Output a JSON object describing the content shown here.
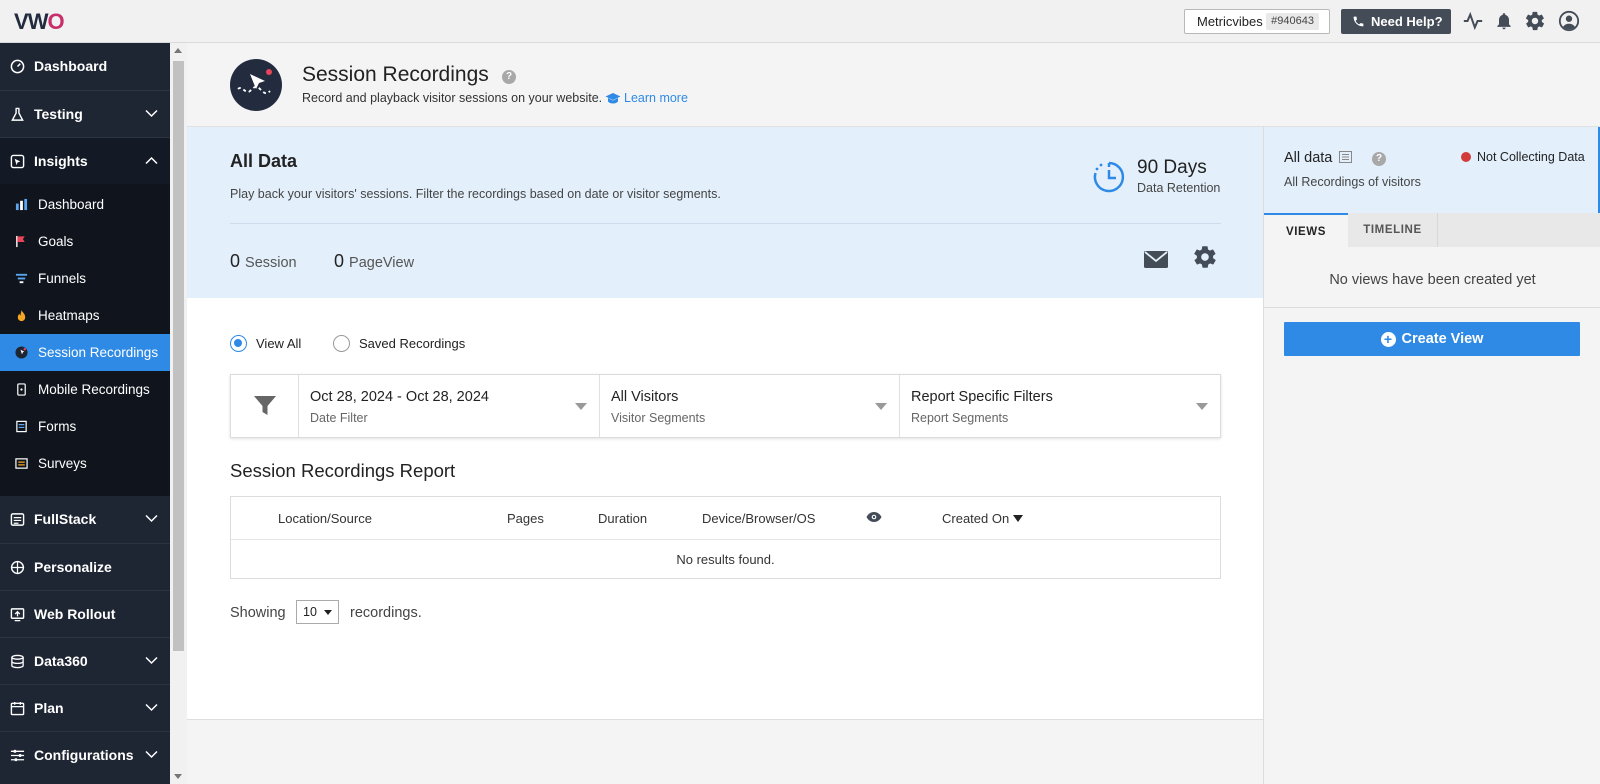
{
  "brand": {
    "logo_v": "V",
    "logo_w": "W",
    "logo_o": "O",
    "accent": "#2f8ae5",
    "logo_pink": "#c72f6a"
  },
  "topbar": {
    "account_name": "Metricvibes",
    "account_id": "#940643",
    "help_label": "Need Help?",
    "icons": [
      "phone-icon",
      "activity-icon",
      "bell-icon",
      "gear-icon",
      "user-avatar-icon"
    ]
  },
  "sidebar": {
    "items": [
      {
        "label": "Dashboard",
        "icon": "dashboard-gauge-icon"
      },
      {
        "label": "Testing",
        "icon": "flask-icon"
      },
      {
        "label": "Insights",
        "icon": "insights-icon"
      },
      {
        "label": "FullStack",
        "icon": "fullstack-icon"
      },
      {
        "label": "Personalize",
        "icon": "crosshair-icon"
      },
      {
        "label": "Web Rollout",
        "icon": "rollout-icon"
      },
      {
        "label": "Data360",
        "icon": "database-icon"
      },
      {
        "label": "Plan",
        "icon": "calendar-icon"
      },
      {
        "label": "Configurations",
        "icon": "sliders-icon"
      }
    ],
    "insights_sub": [
      {
        "label": "Dashboard",
        "icon": "bar-chart-icon"
      },
      {
        "label": "Goals",
        "icon": "flag-icon"
      },
      {
        "label": "Funnels",
        "icon": "funnel-icon"
      },
      {
        "label": "Heatmaps",
        "icon": "flame-icon"
      },
      {
        "label": "Session Recordings",
        "icon": "recording-icon"
      },
      {
        "label": "Mobile Recordings",
        "icon": "mobile-icon"
      },
      {
        "label": "Forms",
        "icon": "form-icon"
      },
      {
        "label": "Surveys",
        "icon": "survey-icon"
      }
    ]
  },
  "header": {
    "title": "Session Recordings",
    "help": "?",
    "subtitle": "Record and playback visitor sessions on your website.",
    "learn_more": "Learn more"
  },
  "panel": {
    "title": "All Data",
    "description": "Play back your visitors' sessions. Filter the recordings based on date or visitor segments.",
    "retention_value": "90 Days",
    "retention_label": "Data Retention",
    "session_count": "0",
    "session_label": "Session",
    "pageview_count": "0",
    "pageview_label": "PageView"
  },
  "view_mode": {
    "view_all": "View All",
    "saved": "Saved Recordings",
    "selected": "View All"
  },
  "filters": [
    {
      "title": "Oct 28, 2024 - Oct 28, 2024",
      "subtitle": "Date Filter"
    },
    {
      "title": "All Visitors",
      "subtitle": "Visitor Segments"
    },
    {
      "title": "Report Specific Filters",
      "subtitle": "Report Segments"
    }
  ],
  "report": {
    "title": "Session Recordings Report",
    "columns": [
      "Location/Source",
      "Pages",
      "Duration",
      "Device/Browser/OS",
      "Created On"
    ],
    "empty": "No results found.",
    "showing_prefix": "Showing",
    "page_size": "10",
    "showing_suffix": "recordings."
  },
  "right_panel": {
    "title": "All data",
    "help": "?",
    "subtitle": "All Recordings of visitors",
    "status": "Not Collecting Data",
    "tabs": [
      "VIEWS",
      "TIMELINE"
    ],
    "empty": "No views have been created yet",
    "create_label": "Create View",
    "create_plus": "+"
  }
}
